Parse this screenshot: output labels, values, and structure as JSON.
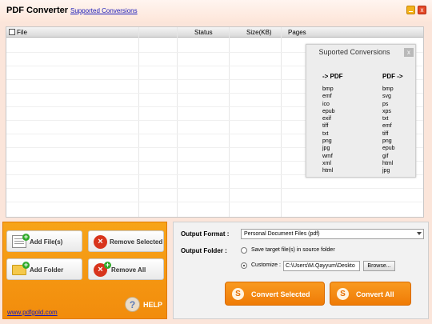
{
  "titlebar": {
    "title": "PDF Converter",
    "link": "Supported Conversions",
    "close": "x"
  },
  "filelist": {
    "columns": [
      "File",
      "Status",
      "Size(KB)",
      "Pages"
    ]
  },
  "popup": {
    "title": "Suported Conversions",
    "close": "x",
    "to_pdf_head": "-> PDF",
    "from_pdf_head": "PDF ->",
    "to_pdf": [
      "bmp",
      "emf",
      "ico",
      "epub",
      "exif",
      "tiff",
      "txt",
      "png",
      "jpg",
      "wmf",
      "xml",
      "html"
    ],
    "from_pdf": [
      "bmp",
      "svg",
      "ps",
      "xps",
      "txt",
      "emf",
      "tiff",
      "png",
      "epub",
      "gif",
      "html",
      "jpg"
    ]
  },
  "actions": {
    "add_files": "Add File(s)",
    "remove_selected": "Remove Selected",
    "add_folder": "Add Folder",
    "remove_all": "Remove All",
    "website": "www.pdfgold.com",
    "help": "HELP"
  },
  "output": {
    "format_label": "Output Format :",
    "format_value": "Personal Document Files (pdf)",
    "folder_label": "Output Folder :",
    "option_source": "Save target file(s) in source folder",
    "option_customize": "Customize :",
    "path_value": "C:\\Users\\M.Qayyum\\Deskto",
    "browse": "Browse...",
    "convert_selected": "Convert Selected",
    "convert_all": "Convert All"
  },
  "colors": {
    "accent_orange": "#f28c0c",
    "link_blue": "#1a1ab8",
    "background": "#fbe5da"
  }
}
